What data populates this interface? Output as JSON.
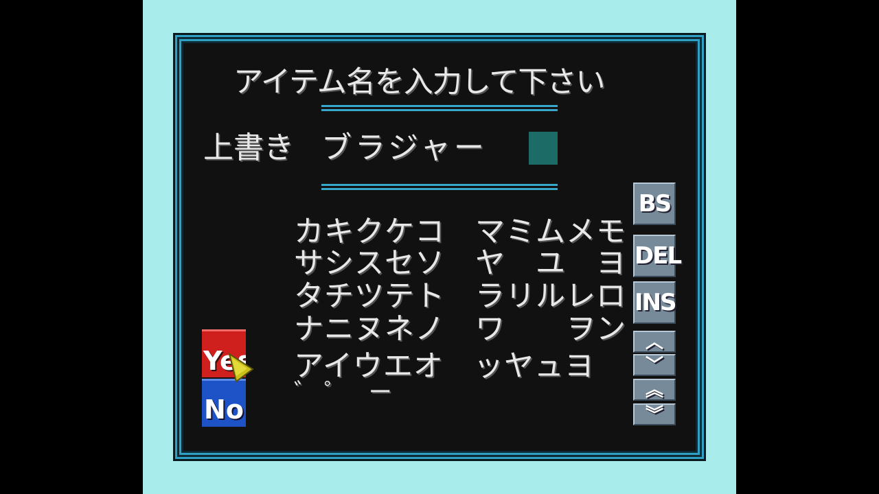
{
  "screen": {
    "title": "アイテム名を入力して下さい",
    "mode_label": "上書き",
    "entry_value": "ブラジャー"
  },
  "kana_grid": {
    "rows": [
      "カキクケコ　マミムメモ",
      "サシスセソ　ヤ　ユ　ヨ",
      "タチツテト　ラリルレロ",
      "ナニヌネノ　ワ　　ヲン",
      "アイウエオ　ッヤュヨ"
    ],
    "marks_row": "゛゜ ー"
  },
  "side_buttons": {
    "bs": "BS",
    "del": "DEL",
    "ins": "INS",
    "up": "︿",
    "down": "﹀",
    "page_up": "︽",
    "page_down": "︾"
  },
  "confirm": {
    "yes": "Yes",
    "no": "No"
  },
  "colors": {
    "background": "#a9ecec",
    "panel": "#111111",
    "frame": "#2f9fc3",
    "cursor": "#1c6b66",
    "yes": "#d0201e",
    "no": "#1d53c6",
    "pointer": "#c9c01a"
  }
}
